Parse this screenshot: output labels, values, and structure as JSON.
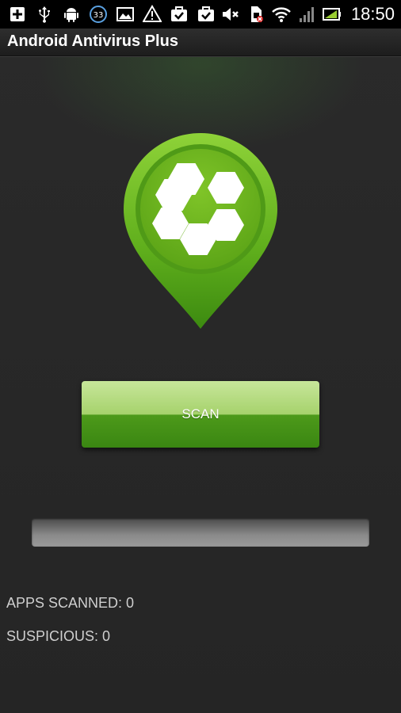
{
  "status_bar": {
    "icons_left": [
      "add-icon",
      "usb-icon",
      "android-icon",
      "notification-count-icon",
      "image-icon",
      "warning-icon",
      "briefcase-check-icon",
      "briefcase-check-icon"
    ],
    "notification_count": "33",
    "icons_right": [
      "mute-icon",
      "no-sim-icon",
      "wifi-icon",
      "signal-icon",
      "battery-charging-icon"
    ],
    "time": "18:50"
  },
  "app": {
    "title": "Android Antivirus Plus"
  },
  "scan": {
    "label": "SCAN"
  },
  "progress": {
    "value": 0
  },
  "stats": {
    "apps_scanned": "APPS SCANNED: 0",
    "suspicious": "SUSPICIOUS: 0"
  },
  "colors": {
    "accent": "#6cb51f",
    "accent_dark": "#3a8612",
    "background": "#262626"
  }
}
